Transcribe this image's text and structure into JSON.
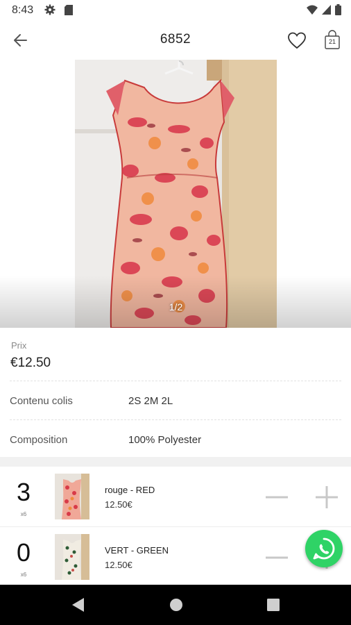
{
  "status_bar": {
    "time": "8:43"
  },
  "header": {
    "title": "6852",
    "cart_count": "21"
  },
  "gallery": {
    "counter": "1/2"
  },
  "product": {
    "price_label": "Prix",
    "price": "€12.50",
    "details": [
      {
        "label": "Contenu colis",
        "value": "2S 2M 2L"
      },
      {
        "label": "Composition",
        "value": "100% Polyester"
      }
    ]
  },
  "variants": [
    {
      "qty": "3",
      "unit": "x6",
      "name": "rouge - RED",
      "price": "12.50€"
    },
    {
      "qty": "0",
      "unit": "x6",
      "name": "VERT - GREEN",
      "price": "12.50€"
    }
  ],
  "colors": {
    "whatsapp": "#2fd366",
    "nav_bar": "#000000",
    "stepper": "#c8c8c8"
  },
  "icons": [
    "settings-icon",
    "sim-card-icon",
    "wifi-icon",
    "signal-icon",
    "battery-icon",
    "back-arrow-icon",
    "heart-icon",
    "shopping-bag-icon",
    "minus-icon",
    "plus-icon",
    "whatsapp-icon",
    "nav-back-icon",
    "nav-home-icon",
    "nav-recents-icon"
  ]
}
